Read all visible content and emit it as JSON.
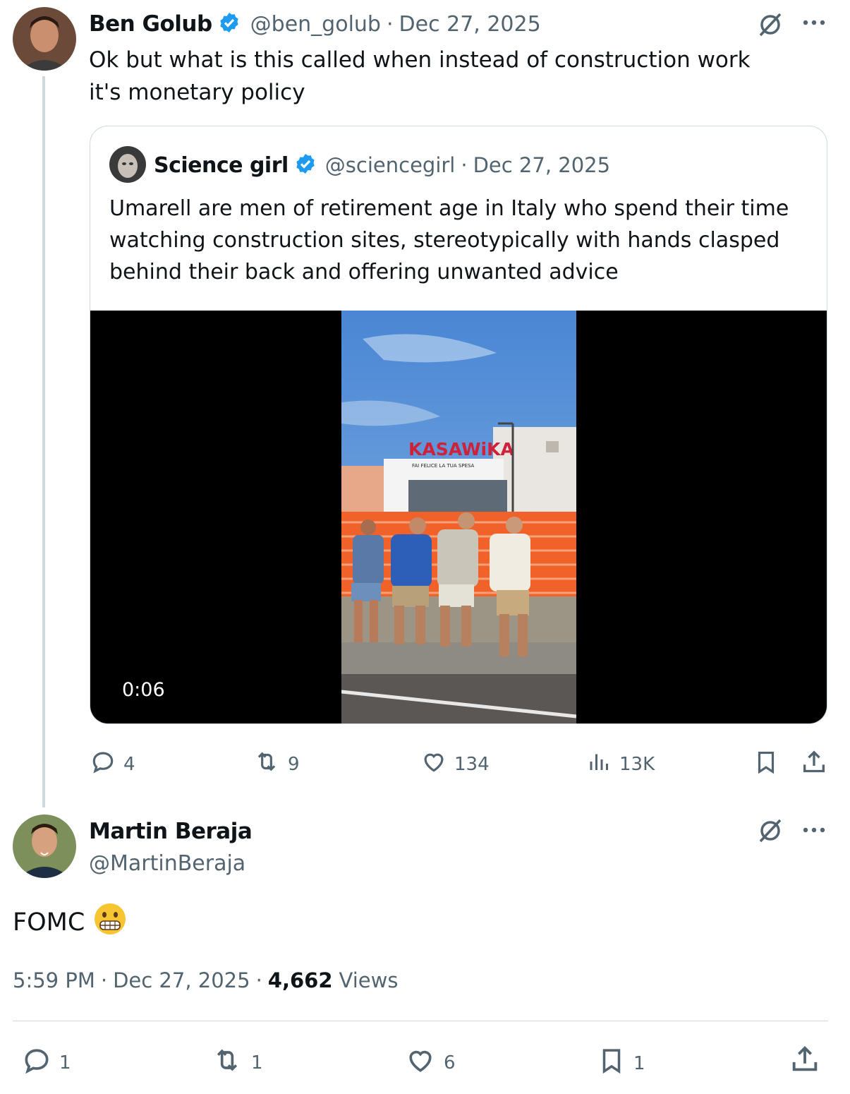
{
  "parent_tweet": {
    "author_name": "Ben Golub",
    "handle": "@ben_golub",
    "date": "Dec 27, 2025",
    "separator": "·",
    "text": "Ok but what is this called when instead of construction work it's monetary policy",
    "quoted": {
      "author_name": "Science girl",
      "handle": "@sciencegirl",
      "date": "Dec 27, 2025",
      "text": "Umarell are men of retirement age in Italy who spend their time watching construction sites, stereotypically with hands clasped behind their back and offering unwanted advice",
      "video": {
        "duration": "0:06",
        "sign_text": "KASAWiKA",
        "sign_subtext": "FAI FELICE LA TUA SPESA"
      }
    },
    "stats": {
      "replies": "4",
      "reposts": "9",
      "likes": "134",
      "views": "13K"
    }
  },
  "main_tweet": {
    "author_name": "Martin Beraja",
    "handle": "@MartinBeraja",
    "text": "FOMC",
    "emoji": "😬",
    "time": "5:59 PM",
    "date": "Dec 27, 2025",
    "separator": "·",
    "views_count": "4,662",
    "views_label": "Views",
    "stats": {
      "replies": "1",
      "reposts": "1",
      "likes": "6",
      "bookmarks": "1"
    }
  },
  "colors": {
    "verified": "#1d9bf0",
    "muted": "#536471",
    "border": "#cfd9de"
  },
  "icons": [
    "grok-icon",
    "more-icon",
    "reply-icon",
    "repost-icon",
    "like-icon",
    "views-icon",
    "bookmark-icon",
    "share-icon",
    "verified-icon"
  ]
}
